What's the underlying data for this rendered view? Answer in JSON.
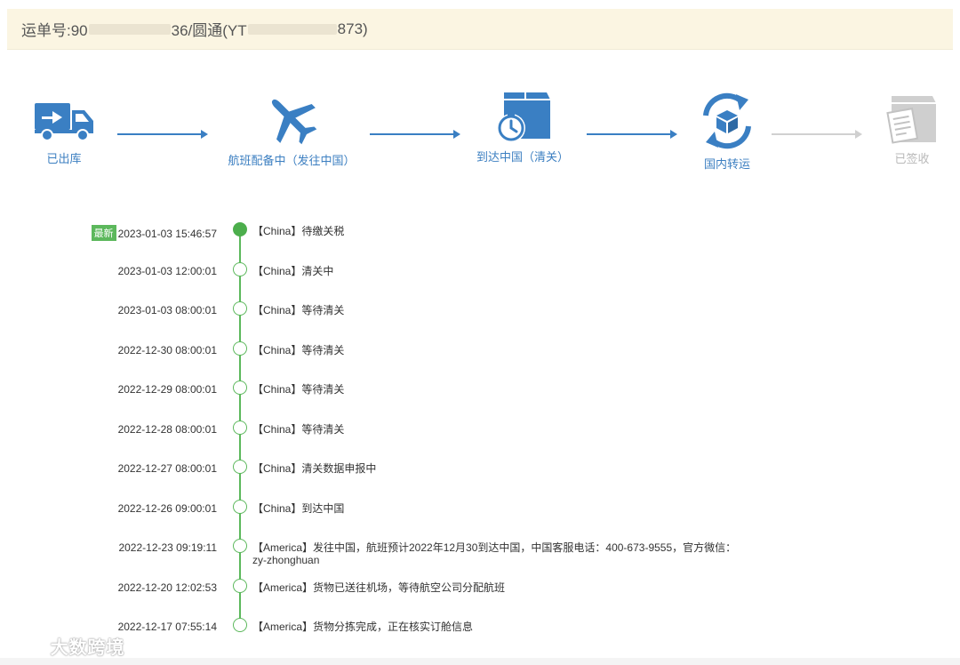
{
  "header": {
    "prefix": "运单号:90",
    "part2": "36/圆通(YT",
    "part3": "873)"
  },
  "steps": [
    {
      "label": "已出库",
      "icon": "truck-icon",
      "status": "done"
    },
    {
      "label": "航班配备中（发往中国）",
      "icon": "airplane-icon",
      "status": "done"
    },
    {
      "label": "到达中国（清关）",
      "icon": "package-timer-icon",
      "status": "done"
    },
    {
      "label": "国内转运",
      "icon": "transfer-cycle-icon",
      "status": "done"
    },
    {
      "label": "已签收",
      "icon": "signed-document-icon",
      "status": "pending"
    }
  ],
  "timeline": {
    "latest_badge": "最新",
    "events": [
      {
        "time": "2023-01-03 15:46:57",
        "desc": "【China】待缴关税"
      },
      {
        "time": "2023-01-03 12:00:01",
        "desc": "【China】清关中"
      },
      {
        "time": "2023-01-03 08:00:01",
        "desc": "【China】等待清关"
      },
      {
        "time": "2022-12-30 08:00:01",
        "desc": "【China】等待清关"
      },
      {
        "time": "2022-12-29 08:00:01",
        "desc": "【China】等待清关"
      },
      {
        "time": "2022-12-28 08:00:01",
        "desc": "【China】等待清关"
      },
      {
        "time": "2022-12-27 08:00:01",
        "desc": "【China】清关数据申报中"
      },
      {
        "time": "2022-12-26 09:00:01",
        "desc": "【China】到达中国"
      },
      {
        "time": "2022-12-23 09:19:11",
        "desc": "【America】发往中国，航班预计2022年12月30到达中国，中国客服电话：400-673-9555，官方微信：zy-zhonghuan"
      },
      {
        "time": "2022-12-20 12:02:53",
        "desc": "【America】货物已送往机场，等待航空公司分配航班"
      },
      {
        "time": "2022-12-17 07:55:14",
        "desc": "【America】货物分拣完成，正在核实订舱信息"
      }
    ]
  },
  "watermark": "大数跨境",
  "colors": {
    "accent": "#3a7fc3",
    "timeline": "#5cb85c",
    "pending": "#c0c0c0",
    "header_bg": "#fbf5e2"
  }
}
